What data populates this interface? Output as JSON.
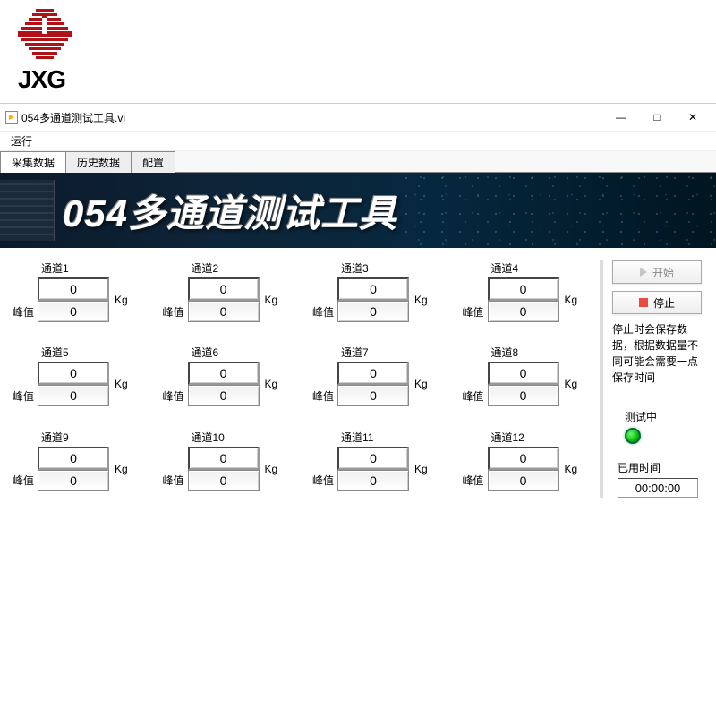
{
  "logo": {
    "text": "JXG"
  },
  "titlebar": {
    "title": "054多通道测试工具.vi"
  },
  "menubar": {
    "run": "运行"
  },
  "tabs": {
    "collect": "采集数据",
    "history": "历史数据",
    "config": "配置"
  },
  "banner": {
    "text_num": "054",
    "text_rest": "多通道测试工具"
  },
  "unit": "Kg",
  "peak_label": "峰值",
  "channels": [
    {
      "name": "通道1",
      "value": "0",
      "peak": "0"
    },
    {
      "name": "通道2",
      "value": "0",
      "peak": "0"
    },
    {
      "name": "通道3",
      "value": "0",
      "peak": "0"
    },
    {
      "name": "通道4",
      "value": "0",
      "peak": "0"
    },
    {
      "name": "通道5",
      "value": "0",
      "peak": "0"
    },
    {
      "name": "通道6",
      "value": "0",
      "peak": "0"
    },
    {
      "name": "通道7",
      "value": "0",
      "peak": "0"
    },
    {
      "name": "通道8",
      "value": "0",
      "peak": "0"
    },
    {
      "name": "通道9",
      "value": "0",
      "peak": "0"
    },
    {
      "name": "通道10",
      "value": "0",
      "peak": "0"
    },
    {
      "name": "通道11",
      "value": "0",
      "peak": "0"
    },
    {
      "name": "通道12",
      "value": "0",
      "peak": "0"
    }
  ],
  "side": {
    "start": "开始",
    "stop": "停止",
    "note": "停止时会保存数据，根据数据量不同可能会需要一点保存时间",
    "status_label": "测试中",
    "time_label": "已用时间",
    "time_value": "00:00:00"
  }
}
